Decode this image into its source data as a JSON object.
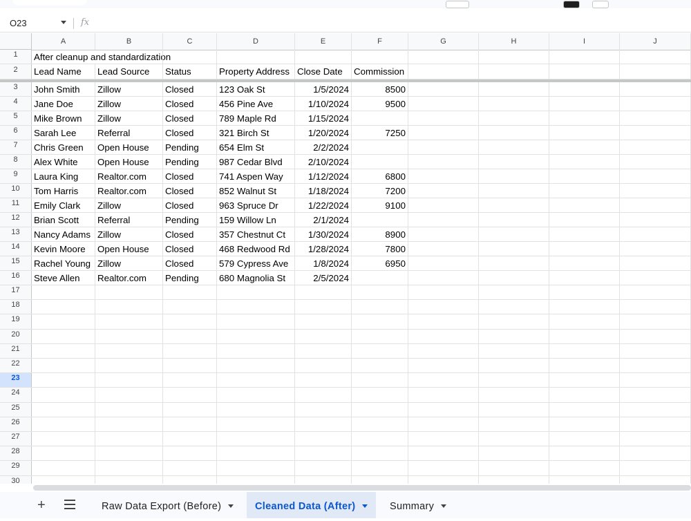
{
  "name_box": "O23",
  "fx_icon": "fx",
  "columns": [
    "A",
    "B",
    "C",
    "D",
    "E",
    "F",
    "G",
    "H",
    "I",
    "J"
  ],
  "row_numbers": [
    "1",
    "2",
    "3",
    "4",
    "5",
    "6",
    "7",
    "8",
    "9",
    "10",
    "11",
    "12",
    "13",
    "14",
    "15",
    "16",
    "17",
    "18",
    "19",
    "20",
    "21",
    "22",
    "23",
    "24",
    "25",
    "26",
    "27",
    "28",
    "29",
    "30"
  ],
  "selected_row": "23",
  "title_cell": "After cleanup and standardization",
  "headers": [
    "Lead Name",
    "Lead Source",
    "Status",
    "Property Address",
    "Close Date",
    "Commission"
  ],
  "rows": [
    [
      "John Smith",
      "Zillow",
      "Closed",
      "123 Oak St",
      "1/5/2024",
      "8500"
    ],
    [
      "Jane Doe",
      "Zillow",
      "Closed",
      "456 Pine Ave",
      "1/10/2024",
      "9500"
    ],
    [
      "Mike Brown",
      "Zillow",
      "Closed",
      "789 Maple Rd",
      "1/15/2024",
      ""
    ],
    [
      "Sarah Lee",
      "Referral",
      "Closed",
      "321 Birch St",
      "1/20/2024",
      "7250"
    ],
    [
      "Chris Green",
      "Open House",
      "Pending",
      "654 Elm St",
      "2/2/2024",
      ""
    ],
    [
      "Alex White",
      "Open House",
      "Pending",
      "987 Cedar Blvd",
      "2/10/2024",
      ""
    ],
    [
      "Laura King",
      "Realtor.com",
      "Closed",
      "741 Aspen Way",
      "1/12/2024",
      "6800"
    ],
    [
      "Tom Harris",
      "Realtor.com",
      "Closed",
      "852 Walnut St",
      "1/18/2024",
      "7200"
    ],
    [
      "Emily Clark",
      "Zillow",
      "Closed",
      "963 Spruce Dr",
      "1/22/2024",
      "9100"
    ],
    [
      "Brian Scott",
      "Referral",
      "Pending",
      "159 Willow Ln",
      "2/1/2024",
      ""
    ],
    [
      "Nancy Adams",
      "Zillow",
      "Closed",
      "357 Chestnut Ct",
      "1/30/2024",
      "8900"
    ],
    [
      "Kevin Moore",
      "Open House",
      "Closed",
      "468 Redwood Rd",
      "1/28/2024",
      "7800"
    ],
    [
      "Rachel Young",
      "Zillow",
      "Closed",
      "579 Cypress Ave",
      "1/8/2024",
      "6950"
    ],
    [
      "Steve Allen",
      "Realtor.com",
      "Pending",
      "680 Magnolia St",
      "2/5/2024",
      ""
    ]
  ],
  "tabs": [
    {
      "label": "Raw Data Export (Before)",
      "active": false
    },
    {
      "label": "Cleaned Data (After)",
      "active": true
    },
    {
      "label": "Summary",
      "active": false
    }
  ],
  "add_sheet_label": "+",
  "colors": {
    "accent": "#0b57d0",
    "selected_header": "#d3e3fd",
    "gridline": "#e1e3e1"
  }
}
